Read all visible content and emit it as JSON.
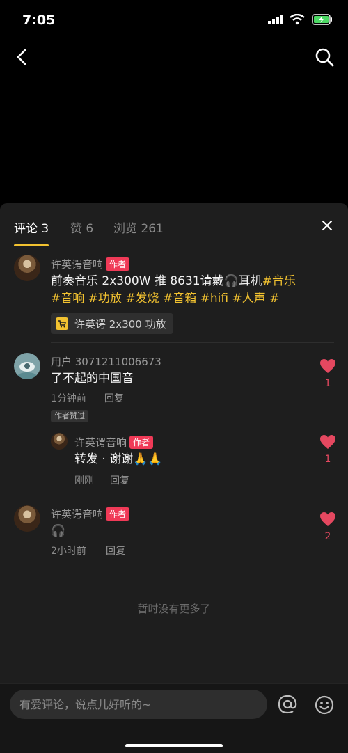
{
  "status_bar": {
    "time": "7:05"
  },
  "tabs": {
    "comments": "评论 3",
    "likes": "赞 6",
    "views": "浏览 261"
  },
  "post": {
    "author": "许英谔音响",
    "author_badge": "作者",
    "text_part1": "前奏音乐 2x300W 推 8631请戴🎧耳机",
    "text_hashtags_line1": "#音乐",
    "text_line2": [
      {
        "t": "#音响",
        "tag": true
      },
      {
        "t": " ",
        "tag": false
      },
      {
        "t": "#功放",
        "tag": true
      },
      {
        "t": " ",
        "tag": false
      },
      {
        "t": "#发烧",
        "tag": true
      },
      {
        "t": " ",
        "tag": false
      },
      {
        "t": "#音箱",
        "tag": true
      },
      {
        "t": " ",
        "tag": false
      },
      {
        "t": "#hifi",
        "tag": true
      },
      {
        "t": " ",
        "tag": false
      },
      {
        "t": "#人声",
        "tag": true
      },
      {
        "t": " ",
        "tag": false
      },
      {
        "t": "#",
        "tag": true
      }
    ],
    "product_label": "许英谔 2x300 功放"
  },
  "comments": [
    {
      "user": "用户 3071211006673",
      "text": "了不起的中国音",
      "time": "1分钟前",
      "reply_label": "回复",
      "liked_badge": "作者赞过",
      "likes": "1"
    },
    {
      "user": "许英谔音响",
      "badge": "作者",
      "text": "转发 · 谢谢🙏🙏",
      "time": "刚刚",
      "reply_label": "回复",
      "likes": "1"
    },
    {
      "user": "许英谔音响",
      "badge": "作者",
      "text": "🎧",
      "time": "2小时前",
      "reply_label": "回复",
      "likes": "2"
    }
  ],
  "no_more_text": "暂时没有更多了",
  "input": {
    "placeholder": "有爱评论，说点儿好听的~"
  },
  "colors": {
    "accent": "#f2c230",
    "author_badge": "#f03a57",
    "like": "#e54860"
  }
}
